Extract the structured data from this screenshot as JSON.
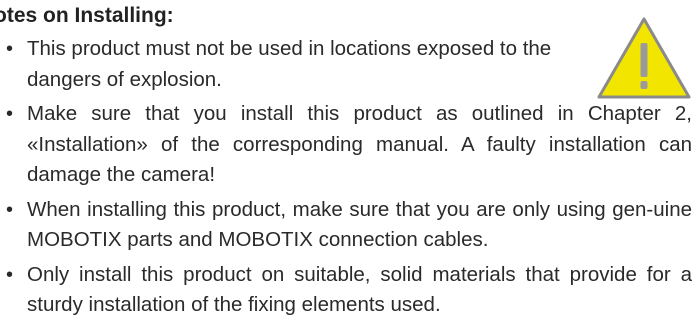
{
  "heading": "otes on Installing:",
  "bullets": [
    {
      "text": "This product must not be used in locations exposed to the dangers of explosion."
    },
    {
      "text": "Make sure that you install this product as outlined in Chapter 2, «Installation» of the corresponding manual. A faulty installation can damage the camera!"
    },
    {
      "text": "When installing this product, make sure that you are only using gen-uine MOBOTIX parts and MOBOTIX connection cables."
    },
    {
      "text": "Only install this product on suitable, solid materials that provide for a sturdy installation of the fixing elements used."
    }
  ],
  "bullet_glyph": "•",
  "warning_icon": {
    "icon": "warning-triangle-icon",
    "fill": "#f2e500",
    "stroke": "#8a8a8a",
    "mark_color": "#9a9a9a"
  }
}
